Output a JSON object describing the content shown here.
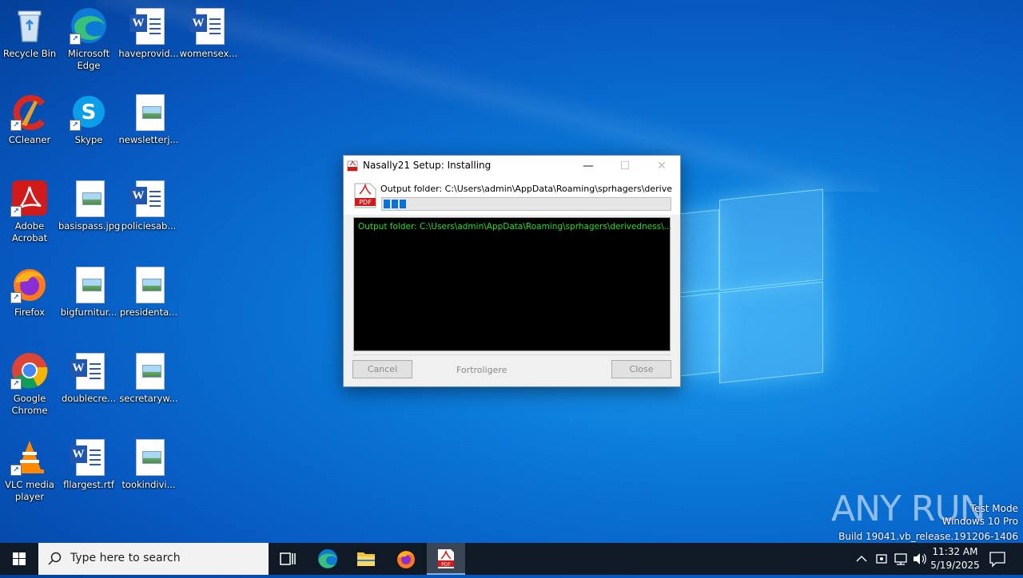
{
  "desktop": {
    "icons": [
      {
        "label": "Recycle Bin"
      },
      {
        "label": "Microsoft Edge"
      },
      {
        "label": "haveprovid..."
      },
      {
        "label": "womensex..."
      },
      {
        "label": "CCleaner"
      },
      {
        "label": "Skype"
      },
      {
        "label": "newsletterj..."
      },
      {
        "label": "Adobe Acrobat"
      },
      {
        "label": "basispass.jpg"
      },
      {
        "label": "policiesab..."
      },
      {
        "label": "Firefox"
      },
      {
        "label": "bigfurnitur..."
      },
      {
        "label": "presidenta..."
      },
      {
        "label": "Google Chrome"
      },
      {
        "label": "doublecre..."
      },
      {
        "label": "secretaryw..."
      },
      {
        "label": "VLC media player"
      },
      {
        "label": "fllargest.rtf"
      },
      {
        "label": "tookindivi..."
      }
    ]
  },
  "dialog": {
    "title": "Nasally21 Setup: Installing",
    "status_text": "Output folder: C:\\Users\\admin\\AppData\\Roaming\\sprhagers\\derivedness\\co",
    "progress_fraction": 0.09,
    "console_line": "Output folder: C:\\Users\\admin\\AppData\\Roaming\\sprhagers\\derivedness\\...",
    "cancel_label": "Cancel",
    "brand_label": "Fortroligere",
    "close_label": "Close"
  },
  "taskbar": {
    "search_placeholder": "Type here to search",
    "time": "11:32 AM",
    "date": "5/19/2025"
  },
  "watermark": {
    "line1": "Test Mode",
    "line2": "Windows 10 Pro",
    "line3": "Build 19041.vb_release.191206-1406",
    "logo_text": "ANY RUN"
  },
  "colors": {
    "console_text": "#22e022",
    "progress": "#0a72d6",
    "taskbar": "#101a26"
  }
}
